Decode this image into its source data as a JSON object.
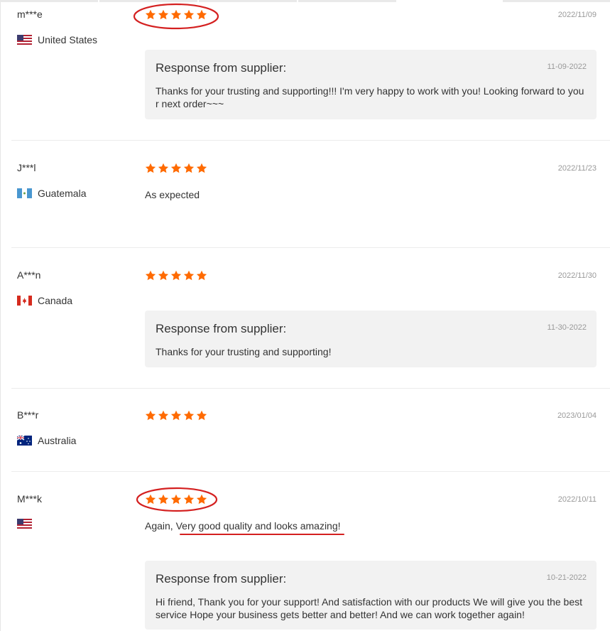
{
  "reviews": [
    {
      "buyer": "m***e",
      "country": "United States",
      "flag_icon": "us-flag-icon",
      "rating": 5,
      "date": "2022/11/09",
      "text": "",
      "response": {
        "title": "Response from supplier:",
        "date": "11-09-2022",
        "text": "Thanks for your trusting and supporting!!! I'm very happy to work with you! Looking forward to your next order~~~"
      }
    },
    {
      "buyer": "J***l",
      "country": "Guatemala",
      "flag_icon": "guatemala-flag-icon",
      "rating": 5,
      "date": "2022/11/23",
      "text": "As expected"
    },
    {
      "buyer": "A***n",
      "country": "Canada",
      "flag_icon": "canada-flag-icon",
      "rating": 5,
      "date": "2022/11/30",
      "text": "",
      "response": {
        "title": "Response from supplier:",
        "date": "11-30-2022",
        "text": "Thanks for your trusting and supporting!"
      }
    },
    {
      "buyer": "B***r",
      "country": "Australia",
      "flag_icon": "australia-flag-icon",
      "rating": 5,
      "date": "2023/01/04",
      "text": ""
    },
    {
      "buyer": "M***k",
      "country": "",
      "flag_icon": "us-flag-icon",
      "rating": 5,
      "date": "2022/10/11",
      "text_prefix": "Again, ",
      "text_highlight": "Very good quality and looks amazing",
      "text_suffix": "!",
      "response": {
        "title": "Response from supplier:",
        "date": "10-21-2022",
        "text": "Hi friend, Thank you for your support! And satisfaction with our products We will give you the best service Hope your business gets better and better! And we can work together again!"
      }
    }
  ],
  "colors": {
    "star": "#ff6a00",
    "annotation": "#d42020",
    "response_bg": "#f2f2f2",
    "muted_text": "#999999"
  }
}
